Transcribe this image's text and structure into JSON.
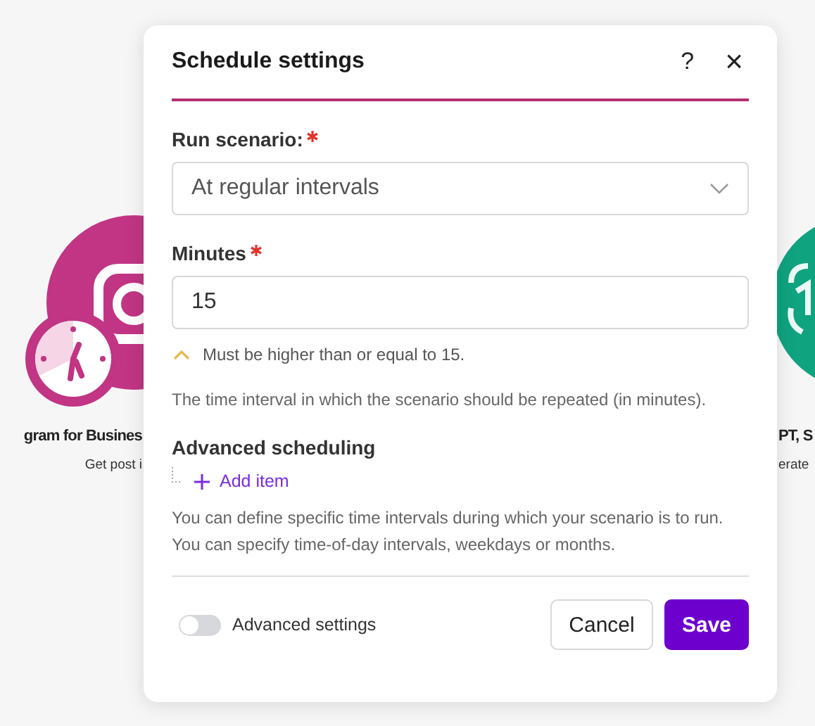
{
  "canvas": {
    "left_module": {
      "title": "gram for Busines",
      "subtitle": "Get post i"
    },
    "right_module": {
      "title": "PT, S",
      "subtitle": "erate"
    }
  },
  "dialog": {
    "title": "Schedule settings",
    "help": "?",
    "close": "×",
    "run_scenario": {
      "label": "Run scenario:",
      "required": true,
      "value": "At regular intervals"
    },
    "minutes": {
      "label": "Minutes",
      "required": true,
      "value": "15",
      "warning": "Must be higher than or equal to 15.",
      "help": "The time interval in which the scenario should be repeated (in minutes)."
    },
    "advanced_scheduling": {
      "label": "Advanced scheduling",
      "add_item": "Add item",
      "help": "You can define specific time intervals during which your scenario is to run. You can specify time-of-day intervals, weekdays or months."
    },
    "advanced_settings": {
      "label": "Advanced settings",
      "on": false
    },
    "buttons": [
      {
        "kind": "secondary",
        "label": "Cancel"
      },
      {
        "kind": "primary",
        "label": "Save"
      }
    ]
  }
}
